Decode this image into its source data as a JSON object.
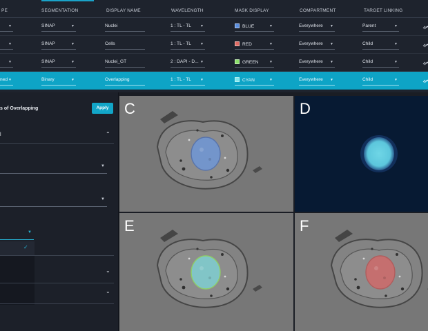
{
  "table": {
    "headers": [
      "PE",
      "SEGMENTATION",
      "DISPLAY NAME",
      "WAVELENGTH",
      "MASK DISPLAY",
      "COMPARTMENT",
      "TARGET LINKING"
    ],
    "rows": [
      {
        "type": "",
        "segmentation": "SINAP",
        "display_name": "Nuclei",
        "wavelength": "1 : TL - TL",
        "mask_display": "BLUE",
        "mask_color": "#5b8fe0",
        "compartment": "Everywhere",
        "target_linking": "Parent",
        "selected": false
      },
      {
        "type": "",
        "segmentation": "SINAP",
        "display_name": "Cells",
        "wavelength": "1 : TL - TL",
        "mask_display": "RED",
        "mask_color": "#e06a63",
        "compartment": "Everywhere",
        "target_linking": "Child",
        "selected": false
      },
      {
        "type": "",
        "segmentation": "SINAP",
        "display_name": "Nuclei_GT",
        "wavelength": "2 : DAPI - D...",
        "mask_display": "GREEN",
        "mask_color": "#8be06a",
        "compartment": "Everywhere",
        "target_linking": "Child",
        "selected": false
      },
      {
        "type": "ned",
        "segmentation": "Binary",
        "display_name": "Overlapping",
        "wavelength": "1 : TL - TL",
        "mask_display": "CYAN",
        "mask_color": "#7fe8ef",
        "compartment": "Everywhere",
        "target_linking": "Child",
        "selected": true
      }
    ]
  },
  "panel": {
    "title": "s of Overlapping",
    "apply_label": "Apply",
    "section_label": "l",
    "icons": {
      "expand": "chevron-up-icon",
      "collapse": "chevron-down-icon",
      "check": "check-icon",
      "link": "link-icon"
    }
  },
  "images": [
    {
      "letter": "C",
      "overlay": "blue"
    },
    {
      "letter": "D",
      "overlay": "fluorescence"
    },
    {
      "letter": "E",
      "overlay": "green-cyan"
    },
    {
      "letter": "F",
      "overlay": "red"
    }
  ]
}
